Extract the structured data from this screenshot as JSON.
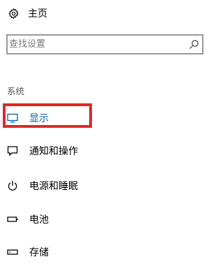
{
  "home": {
    "label": "主页",
    "icon": "gear-icon"
  },
  "search": {
    "placeholder": "查找设置",
    "icon": "search-icon"
  },
  "section": {
    "title": "系统"
  },
  "nav": {
    "items": [
      {
        "label": "显示",
        "icon": "monitor-icon",
        "active": true
      },
      {
        "label": "通知和操作",
        "icon": "notification-icon"
      },
      {
        "label": "电源和睡眠",
        "icon": "power-icon"
      },
      {
        "label": "电池",
        "icon": "battery-icon"
      },
      {
        "label": "存储",
        "icon": "storage-icon"
      }
    ]
  },
  "colors": {
    "accent": "#0063b1",
    "highlight": "#e0262c",
    "border": "#999999"
  }
}
